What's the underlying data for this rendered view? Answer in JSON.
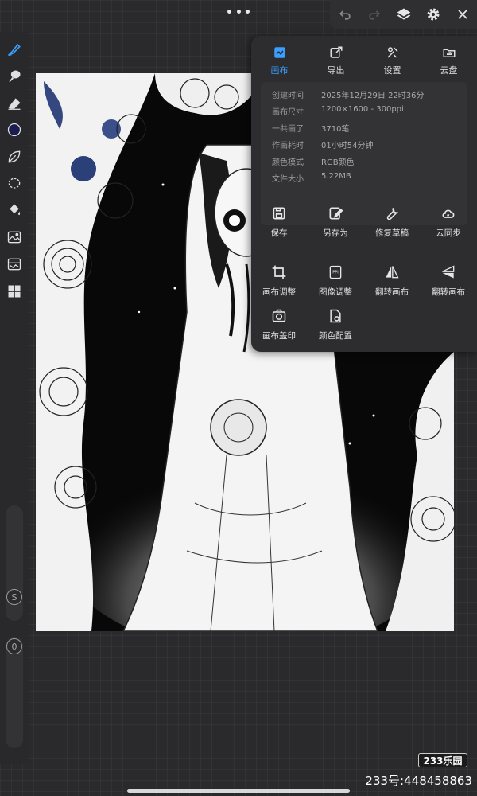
{
  "toolbar": {
    "undo_icon": "undo-icon",
    "redo_icon": "redo-icon",
    "layers_icon": "layers-icon",
    "settings_icon": "gear-icon",
    "close_icon": "close-icon"
  },
  "sidebar": {
    "tools": [
      "brush-icon",
      "smudge-icon",
      "eraser-icon",
      "color-swatch",
      "leaf-icon",
      "lasso-icon",
      "fill-icon",
      "image-icon",
      "reference-icon",
      "layout-icon"
    ],
    "size_label": "S",
    "opacity_label": "0",
    "active_color": "#1c1c52"
  },
  "panel": {
    "tabs": [
      {
        "label": "画布",
        "icon": "canvas-icon",
        "active": true
      },
      {
        "label": "导出",
        "icon": "export-icon",
        "active": false
      },
      {
        "label": "设置",
        "icon": "tools-icon",
        "active": false
      },
      {
        "label": "云盘",
        "icon": "cloud-folder-icon",
        "active": false
      }
    ],
    "info": [
      {
        "key": "创建时间",
        "value": "2025年12月29日 22时36分"
      },
      {
        "key": "画布尺寸",
        "value": "1200×1600 - 300ppi"
      },
      {
        "key": "一共画了",
        "value": "3710笔"
      },
      {
        "key": "作画耗时",
        "value": "01小时54分钟"
      },
      {
        "key": "颜色模式",
        "value": "RGB颜色"
      },
      {
        "key": "文件大小",
        "value": "5.22MB"
      }
    ],
    "actions": [
      {
        "label": "保存",
        "icon": "save-icon"
      },
      {
        "label": "另存为",
        "icon": "save-as-icon"
      },
      {
        "label": "修复草稿",
        "icon": "wrench-icon"
      },
      {
        "label": "云同步",
        "icon": "cloud-sync-icon"
      },
      {
        "label": "画布调整",
        "icon": "crop-icon"
      },
      {
        "label": "图像调整",
        "icon": "ppi-icon"
      },
      {
        "label": "翻转画布",
        "icon": "flip-horizontal-icon"
      },
      {
        "label": "翻转画布",
        "icon": "flip-vertical-icon"
      },
      {
        "label": "画布盖印",
        "icon": "camera-stamp-icon"
      },
      {
        "label": "颜色配置",
        "icon": "color-profile-icon"
      }
    ]
  },
  "watermark": {
    "logo": "233乐园",
    "id_text": "233号:448458863"
  },
  "colors": {
    "accent": "#3aa0ff",
    "panel_bg": "#2d2d2f",
    "canvas_bg": "#0a0a0a"
  }
}
